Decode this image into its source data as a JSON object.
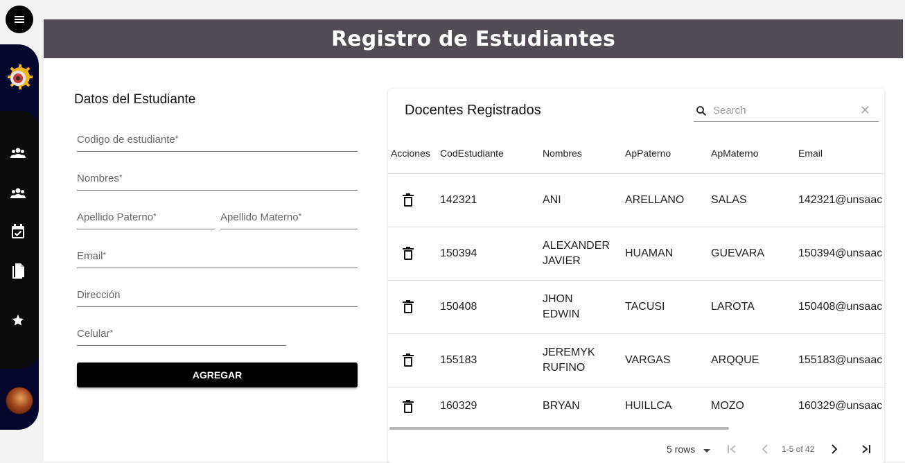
{
  "header": {
    "title": "Registro de Estudiantes"
  },
  "sidebar": {
    "items": [
      {
        "icon": "group-icon"
      },
      {
        "icon": "group-icon"
      },
      {
        "icon": "event-check-icon"
      },
      {
        "icon": "copy-icon"
      },
      {
        "icon": "star-icon"
      }
    ]
  },
  "form": {
    "title": "Datos del Estudiante",
    "fields": {
      "codigo": "Codigo de estudiante",
      "nombres": "Nombres",
      "ap_paterno": "Apellido Paterno",
      "ap_materno": "Apellido Materno",
      "email": "Email",
      "direccion": "Dirección",
      "celular": "Celular"
    },
    "required_mark": "*",
    "submit_label": "AGREGAR"
  },
  "table": {
    "title": "Docentes Registrados",
    "search_placeholder": "Search",
    "columns": [
      "Acciones",
      "CodEstudiante",
      "Nombres",
      "ApPaterno",
      "ApMaterno",
      "Email"
    ],
    "rows": [
      {
        "cod": "142321",
        "nombres": [
          "ANI"
        ],
        "ap_paterno": "ARELLANO",
        "ap_materno": "SALAS",
        "email": "142321@unsaac"
      },
      {
        "cod": "150394",
        "nombres": [
          "ALEXANDER",
          "JAVIER"
        ],
        "ap_paterno": "HUAMAN",
        "ap_materno": "GUEVARA",
        "email": "150394@unsaac"
      },
      {
        "cod": "150408",
        "nombres": [
          "JHON",
          "EDWIN"
        ],
        "ap_paterno": "TACUSI",
        "ap_materno": "LAROTA",
        "email": "150408@unsaac"
      },
      {
        "cod": "155183",
        "nombres": [
          "JEREMYK",
          "RUFINO"
        ],
        "ap_paterno": "VARGAS",
        "ap_materno": "ARQQUE",
        "email": "155183@unsaac"
      },
      {
        "cod": "160329",
        "nombres": [
          "BRYAN"
        ],
        "ap_paterno": "HUILLCA",
        "ap_materno": "MOZO",
        "email": "160329@unsaac"
      }
    ],
    "pagination": {
      "rows_per_page": "5 rows",
      "range": "1-5 of 42"
    }
  }
}
